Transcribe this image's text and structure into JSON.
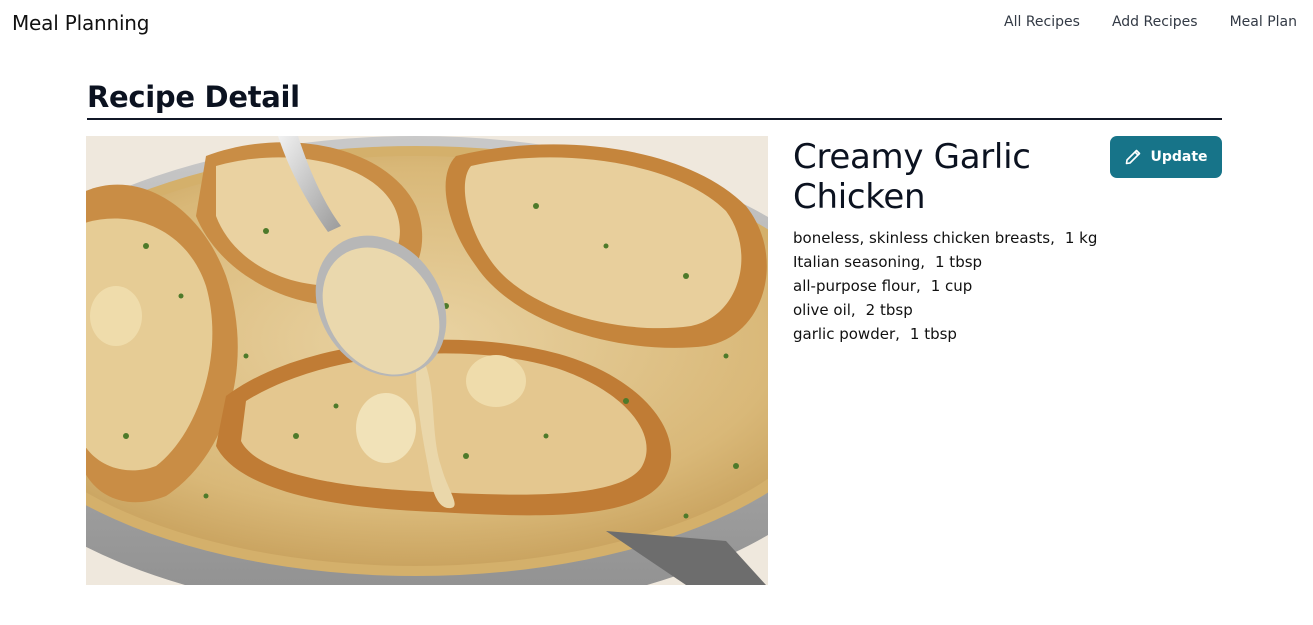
{
  "header": {
    "brand": "Meal Planning",
    "nav": [
      {
        "label": "All Recipes"
      },
      {
        "label": "Add Recipes"
      },
      {
        "label": "Meal Plan"
      }
    ]
  },
  "page": {
    "title": "Recipe Detail"
  },
  "recipe": {
    "name": "Creamy Garlic Chicken",
    "image_icon": "creamy-garlic-chicken-photo",
    "update_label": "Update",
    "update_icon": "pencil-icon",
    "accent_color": "#177489",
    "ingredients": [
      {
        "name": "boneless, skinless chicken breasts,",
        "qty": "1 kg"
      },
      {
        "name": "Italian seasoning,",
        "qty": "1 tbsp"
      },
      {
        "name": "all-purpose flour,",
        "qty": "1 cup"
      },
      {
        "name": "olive oil,",
        "qty": "2 tbsp"
      },
      {
        "name": "garlic powder,",
        "qty": "1 tbsp"
      }
    ]
  }
}
